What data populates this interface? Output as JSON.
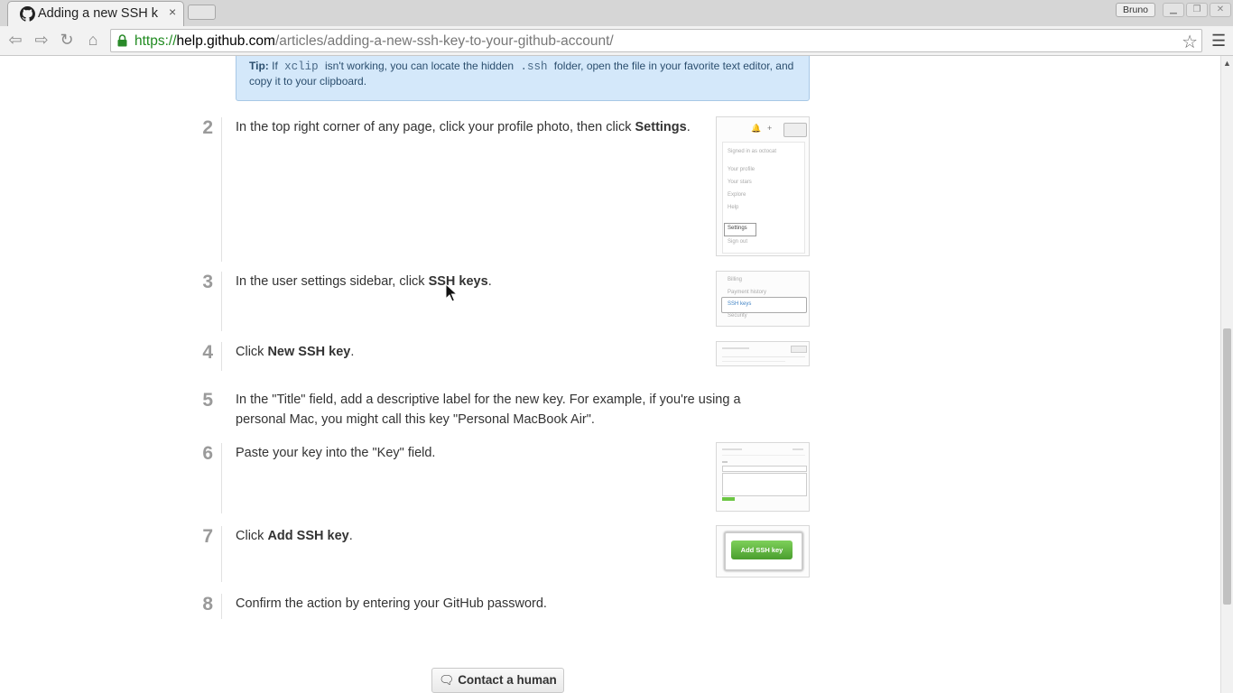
{
  "browser": {
    "tab_title": "Adding a new SSH k",
    "tab_close": "×",
    "profile_name": "Bruno",
    "url_scheme": "https://",
    "url_host": "help.github.com",
    "url_path": "/articles/adding-a-new-ssh-key-to-your-github-account/"
  },
  "tip": {
    "label": "Tip:",
    "part1": "If",
    "code1": "xclip",
    "part2": "isn't working, you can locate the hidden",
    "code2": ".ssh",
    "part3": "folder, open the file in your favorite text editor, and copy it to your clipboard."
  },
  "steps": [
    {
      "num": "2",
      "pre": "In the top right corner of any page, click your profile photo, then click ",
      "bold": "Settings",
      "post": "."
    },
    {
      "num": "3",
      "pre": "In the user settings sidebar, click ",
      "bold": "SSH keys",
      "post": "."
    },
    {
      "num": "4",
      "pre": "Click ",
      "bold": "New SSH key",
      "post": "."
    },
    {
      "num": "5",
      "pre": "In the \"Title\" field, add a descriptive label for the new key. For example, if you're using a personal Mac, you might call this key \"Personal MacBook Air\".",
      "bold": "",
      "post": ""
    },
    {
      "num": "6",
      "pre": "Paste your key into the \"Key\" field.",
      "bold": "",
      "post": ""
    },
    {
      "num": "7",
      "pre": "Click ",
      "bold": "Add SSH key",
      "post": "."
    },
    {
      "num": "8",
      "pre": "Confirm the action by entering your GitHub password.",
      "bold": "",
      "post": ""
    }
  ],
  "screenshots": {
    "menu": {
      "signed_in": "Signed in as octocat",
      "items": [
        "Your profile",
        "Your stars",
        "Explore",
        "Help"
      ],
      "settings": "Settings",
      "sign_out": "Sign out"
    },
    "sidebar": {
      "items": [
        "Billing",
        "Payment history",
        "SSH keys",
        "Security"
      ]
    },
    "add_button": "Add SSH key"
  },
  "contact_label": "Contact a human"
}
